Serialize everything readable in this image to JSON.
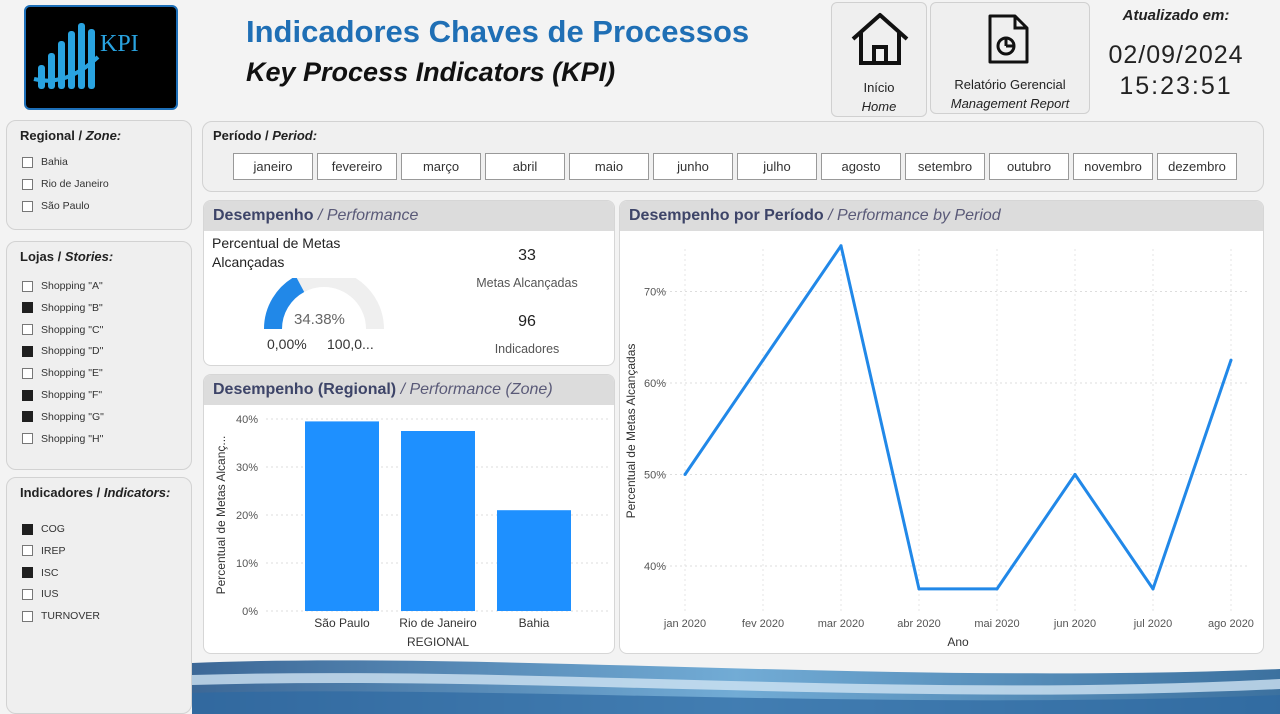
{
  "header": {
    "title_pt": "Indicadores Chaves de Processos",
    "title_en": "Key Process Indicators (KPI)",
    "logo_text": "KPI",
    "home_label_pt": "Início",
    "home_label_en": "Home",
    "report_label_pt": "Relatório Gerencial",
    "report_label_en": "Management Report",
    "updated_label": "Atualizado em:",
    "updated_date": "02/09/2024",
    "updated_time": "15:23:51"
  },
  "filters": {
    "regional": {
      "title_pt": "Regional /",
      "title_en": "Zone:",
      "items": [
        {
          "label": "Bahia",
          "checked": false
        },
        {
          "label": "Rio de Janeiro",
          "checked": false
        },
        {
          "label": "São Paulo",
          "checked": false
        }
      ]
    },
    "lojas": {
      "title_pt": "Lojas /",
      "title_en": "Stories:",
      "items": [
        {
          "label": "Shopping \"A\"",
          "checked": false
        },
        {
          "label": "Shopping \"B\"",
          "checked": true
        },
        {
          "label": "Shopping \"C\"",
          "checked": false
        },
        {
          "label": "Shopping \"D\"",
          "checked": true
        },
        {
          "label": "Shopping \"E\"",
          "checked": false
        },
        {
          "label": "Shopping \"F\"",
          "checked": true
        },
        {
          "label": "Shopping \"G\"",
          "checked": true
        },
        {
          "label": "Shopping \"H\"",
          "checked": false
        }
      ]
    },
    "indicadores": {
      "title_pt": "Indicadores /",
      "title_en": "Indicators:",
      "items": [
        {
          "label": "COG",
          "checked": true
        },
        {
          "label": "IREP",
          "checked": false
        },
        {
          "label": "ISC",
          "checked": true
        },
        {
          "label": "IUS",
          "checked": false
        },
        {
          "label": "TURNOVER",
          "checked": false
        }
      ]
    }
  },
  "period": {
    "title_pt": "Período /",
    "title_en": "Period:",
    "months": [
      "janeiro",
      "fevereiro",
      "março",
      "abril",
      "maio",
      "junho",
      "julho",
      "agosto",
      "setembro",
      "outubro",
      "novembro",
      "dezembro"
    ]
  },
  "performance": {
    "title_pt": "Desempenho",
    "title_en": "/ Performance",
    "gauge_title": "Percentual de Metas Alcançadas",
    "gauge_value_label": "34.38%",
    "gauge_value": 0.3438,
    "gauge_min": "0,00%",
    "gauge_max": "100,0...",
    "goals_value": "33",
    "goals_label": "Metas Alcançadas",
    "indicators_value": "96",
    "indicators_label": "Indicadores",
    "accent": "#2188e8"
  },
  "chart_data": [
    {
      "type": "bar",
      "title_pt": "Desempenho (Regional)",
      "title_en": "/ Performance (Zone)",
      "categories": [
        "São Paulo",
        "Rio de Janeiro",
        "Bahia"
      ],
      "values": [
        39.5,
        37.5,
        21
      ],
      "xlabel": "REGIONAL",
      "ylabel": "Percentual de Metas Alcanç...",
      "ylim": [
        0,
        40
      ],
      "yticks": [
        "0%",
        "10%",
        "20%",
        "30%",
        "40%"
      ],
      "color": "#1e90ff",
      "grid": true
    },
    {
      "type": "line",
      "title_pt": "Desempenho por Período",
      "title_en": "/ Performance by  Period",
      "x": [
        "jan 2020",
        "fev 2020",
        "mar 2020",
        "abr 2020",
        "mai 2020",
        "jun 2020",
        "jul 2020",
        "ago 2020"
      ],
      "values": [
        50,
        62.5,
        75,
        37.5,
        37.5,
        50,
        37.5,
        62.5
      ],
      "xlabel": "Ano",
      "ylabel": "Percentual de Metas Alcançadas",
      "yticks": [
        "40%",
        "50%",
        "60%",
        "70%"
      ],
      "color": "#2188e8",
      "grid": true
    }
  ]
}
